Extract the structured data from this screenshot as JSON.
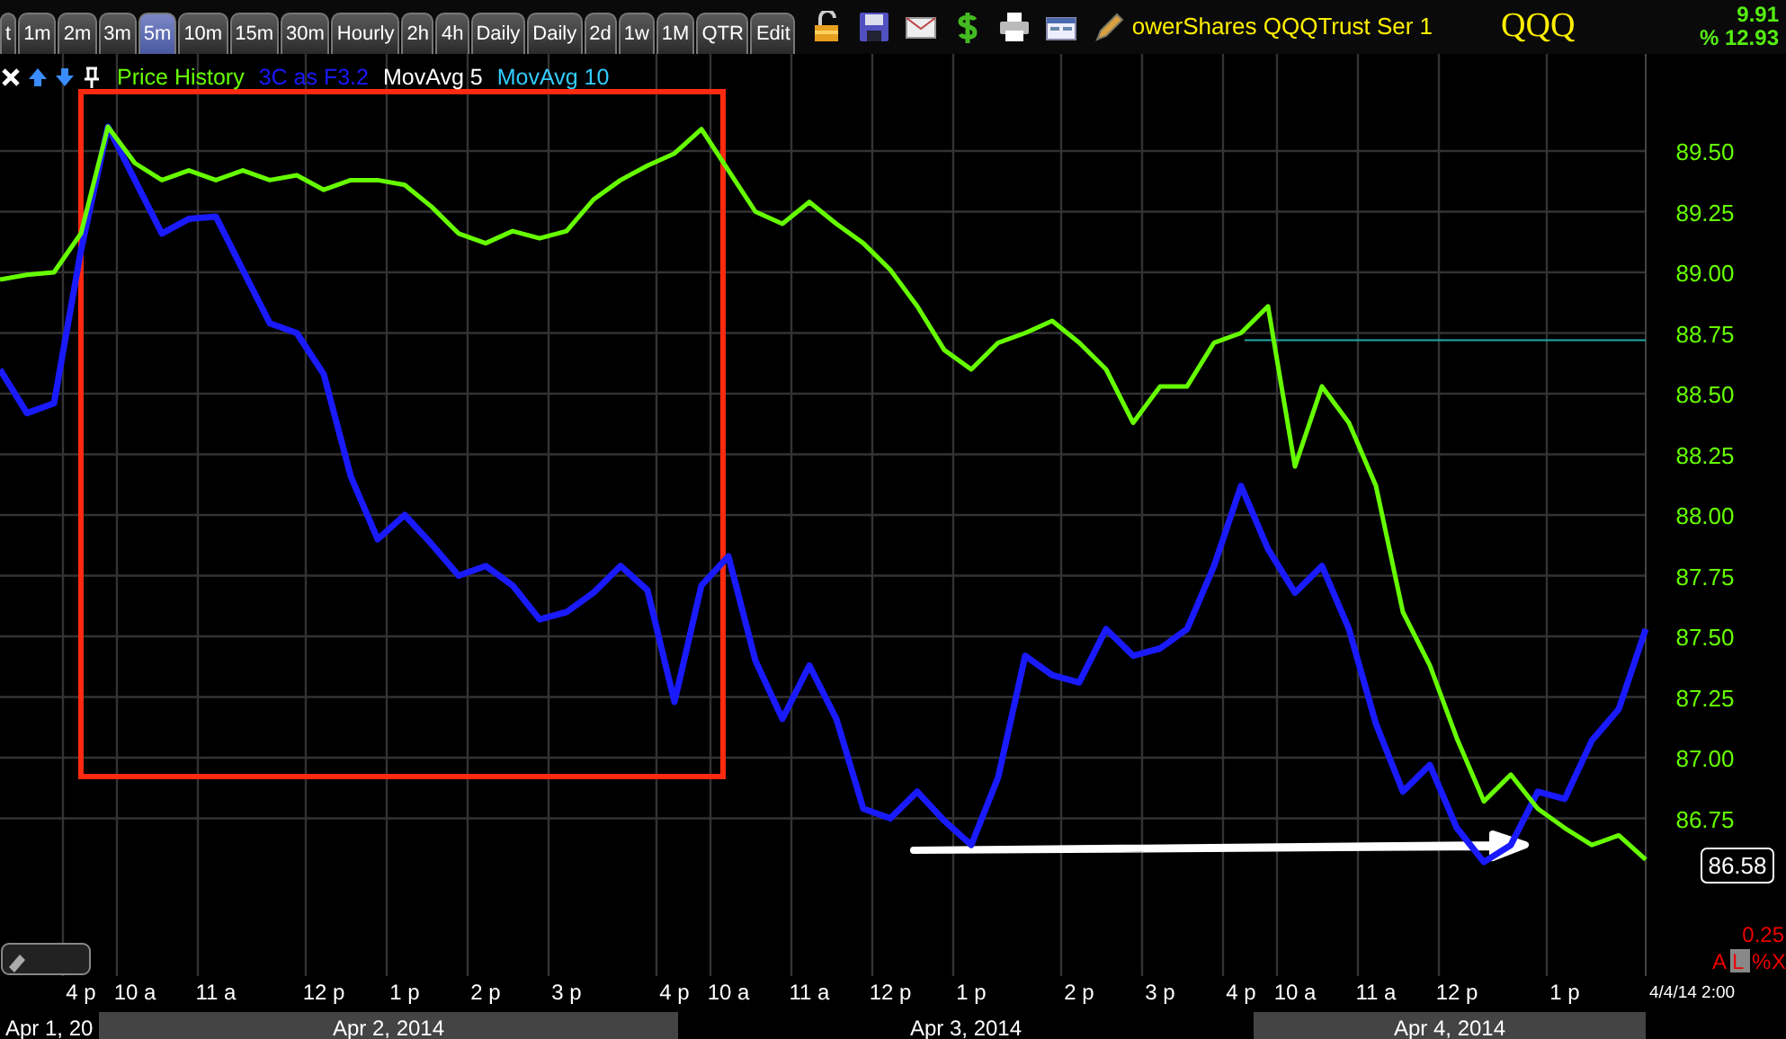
{
  "tabs": [
    {
      "label": "t",
      "selected": false
    },
    {
      "label": "1m",
      "selected": false
    },
    {
      "label": "2m",
      "selected": false
    },
    {
      "label": "3m",
      "selected": false
    },
    {
      "label": "5m",
      "selected": true
    },
    {
      "label": "10m",
      "selected": false
    },
    {
      "label": "15m",
      "selected": false
    },
    {
      "label": "30m",
      "selected": false
    },
    {
      "label": "Hourly",
      "selected": false
    },
    {
      "label": "2h",
      "selected": false
    },
    {
      "label": "4h",
      "selected": false
    },
    {
      "label": "Daily",
      "selected": false
    },
    {
      "label": "Daily",
      "selected": false
    },
    {
      "label": "2d",
      "selected": false
    },
    {
      "label": "1w",
      "selected": false
    },
    {
      "label": "1M",
      "selected": false
    },
    {
      "label": "QTR",
      "selected": false
    },
    {
      "label": "Edit",
      "selected": false
    }
  ],
  "security_name": "owerShares QQQTrust Ser 1",
  "symbol": "QQQ",
  "change": "9.91",
  "change_percent": "% 12.93",
  "legend": [
    {
      "label": "MovAvg 5",
      "color": "#ffffff"
    },
    {
      "label": "MovAvg 10",
      "color": "#33ccff"
    }
  ],
  "chart": {
    "chart_data": {
      "type": "line",
      "categories": [
        null,
        null,
        null,
        "4 p",
        null,
        "10 a",
        null,
        null,
        "11 a",
        null,
        null,
        null,
        "12 p",
        null,
        null,
        "1 p",
        null,
        null,
        "2 p",
        null,
        null,
        "3 p",
        null,
        null,
        null,
        "4 p",
        null,
        "10 a",
        null,
        null,
        "11 a",
        null,
        null,
        "12 p",
        null,
        null,
        "1 p",
        null,
        null,
        null,
        "2 p",
        null,
        null,
        "3 p",
        null,
        null,
        "4 p",
        null,
        "10 a",
        null,
        null,
        "11 a",
        null,
        null,
        "12 p",
        null,
        null,
        null,
        "1 p",
        null,
        null,
        null
      ],
      "series": [
        {
          "name": "Price History",
          "color": "#66ff00",
          "values": [
            88.97,
            88.99,
            89.0,
            89.16,
            89.6,
            89.45,
            89.38,
            89.42,
            89.38,
            89.42,
            89.38,
            89.4,
            89.34,
            89.38,
            89.38,
            89.36,
            89.27,
            89.16,
            89.12,
            89.17,
            89.14,
            89.17,
            89.3,
            89.38,
            89.44,
            89.49,
            89.59,
            89.42,
            89.25,
            89.2,
            89.29,
            89.2,
            89.12,
            89.01,
            88.86,
            88.68,
            88.6,
            88.71,
            88.75,
            88.8,
            88.71,
            88.6,
            88.38,
            88.53,
            88.53,
            88.71,
            88.75,
            88.86,
            88.2,
            88.53,
            88.38,
            88.12,
            87.6,
            87.38,
            87.08,
            86.82,
            86.93,
            86.79,
            86.71,
            86.64,
            86.68,
            86.58
          ]
        },
        {
          "name": "3C as F3.2",
          "color": "#1a1aff",
          "values": [
            88.6,
            88.42,
            88.46,
            89.09,
            89.6,
            89.38,
            89.16,
            89.22,
            89.23,
            89.01,
            88.79,
            88.75,
            88.58,
            88.16,
            87.9,
            88.0,
            87.88,
            87.75,
            87.79,
            87.71,
            87.57,
            87.6,
            87.68,
            87.79,
            87.69,
            87.23,
            87.71,
            87.83,
            87.4,
            87.16,
            87.38,
            87.16,
            86.79,
            86.75,
            86.86,
            86.74,
            86.64,
            86.92,
            87.42,
            87.34,
            87.31,
            87.53,
            87.42,
            87.45,
            87.53,
            87.79,
            88.12,
            87.86,
            87.68,
            87.79,
            87.53,
            87.14,
            86.86,
            86.97,
            86.71,
            86.57,
            86.64,
            86.86,
            86.83,
            87.07,
            87.2,
            87.53
          ]
        }
      ],
      "ylim": [
        86.1,
        89.9
      ],
      "grid": true,
      "yticks": [
        {
          "value": 86.75,
          "label": "86.75"
        },
        {
          "value": 87.0,
          "label": "87.00"
        },
        {
          "value": 87.25,
          "label": "87.25"
        },
        {
          "value": 87.5,
          "label": "87.50"
        },
        {
          "value": 87.75,
          "label": "87.75"
        },
        {
          "value": 88.0,
          "label": "88.00"
        },
        {
          "value": 88.25,
          "label": "88.25"
        },
        {
          "value": 88.5,
          "label": "88.50"
        },
        {
          "value": 88.75,
          "label": "88.75"
        },
        {
          "value": 89.0,
          "label": "89.00"
        },
        {
          "value": 89.25,
          "label": "89.25"
        },
        {
          "value": 89.5,
          "label": "89.50"
        }
      ],
      "ref_lines": [
        {
          "axis": "y",
          "value": 88.72
        }
      ]
    },
    "current_price": "86.58",
    "scale_step": "0.25",
    "scale_buttons": [
      {
        "label": "A",
        "selected": false
      },
      {
        "label": "L",
        "selected": true
      },
      {
        "label": "%",
        "selected": false
      },
      {
        "label": "X",
        "selected": false
      }
    ],
    "timestamp": "4/4/14 2:00",
    "dates": [
      {
        "label": "Apr 1, 20",
        "highlighted": false
      },
      {
        "label": "Apr 2, 2014",
        "highlighted": true
      },
      {
        "label": "Apr 3, 2014",
        "highlighted": false
      },
      {
        "label": "Apr 4, 2014",
        "highlighted": true
      }
    ]
  }
}
